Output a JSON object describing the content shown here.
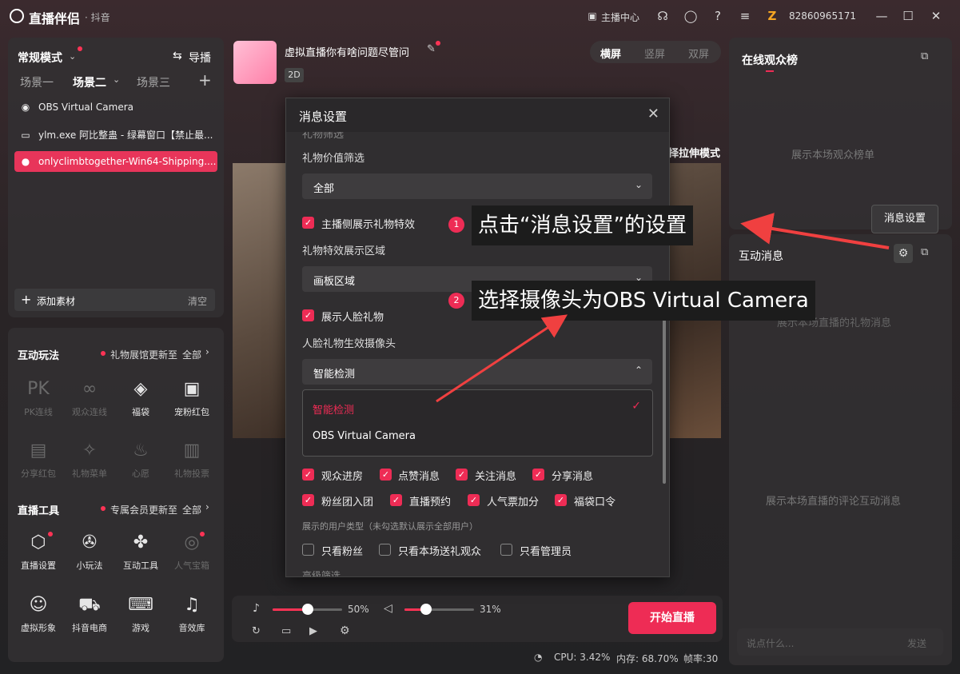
{
  "topbar": {
    "app_name": "直播伴侣",
    "platform": "· 抖音",
    "host_center": "主播中心",
    "user_id": "82860965171"
  },
  "left": {
    "mode": "常规模式",
    "guide": "导播",
    "scenes": [
      "场景一",
      "场景二",
      "场景三"
    ],
    "sources": [
      {
        "label": "OBS Virtual Camera"
      },
      {
        "label": "ylm.exe 阿比整蛊 - 绿幕窗口【禁止最..."
      },
      {
        "label": "onlyclimbtogether-Win64-Shipping...."
      }
    ],
    "add_source": "添加素材",
    "clear": "清空",
    "interactive_title": "互动玩法",
    "interactive_note": "礼物展馆更新至",
    "all": "全部",
    "interactive_tools": [
      "PK连线",
      "观众连线",
      "福袋",
      "宠粉红包",
      "分享红包",
      "礼物菜单",
      "心愿",
      "礼物投票"
    ],
    "tools_title": "直播工具",
    "tools_note": "专属会员更新至",
    "tools": [
      "直播设置",
      "小玩法",
      "互动工具",
      "人气宝箱",
      "虚拟形象",
      "抖音电商",
      "游戏",
      "音效库"
    ]
  },
  "center": {
    "stream_title": "虚拟直播你有啥问题尽管问",
    "tag": "2D",
    "orient": [
      "横屏",
      "竖屏",
      "双屏"
    ],
    "stretch_mode": "择拉伸模式",
    "mic_percent": "50%",
    "speaker_percent": "31%",
    "start": "开始直播",
    "cpu": "CPU: 3.42%",
    "mem": "内存: 68.70%",
    "fps": "帧率:30"
  },
  "dialog": {
    "title": "消息设置",
    "partial_top": "礼物筛选",
    "gift_value_label": "礼物价值筛选",
    "gift_value": "全部",
    "show_gift_effect": "主播侧展示礼物特效",
    "effect_area_label": "礼物特效展示区域",
    "effect_area": "画板区域",
    "show_face_gift": "展示人脸礼物",
    "face_camera_label": "人脸礼物生效摄像头",
    "face_camera": "智能检测",
    "options": [
      "智能检测",
      "OBS Virtual Camera"
    ],
    "checks_row1": [
      "观众进房",
      "点赞消息",
      "关注消息",
      "分享消息"
    ],
    "checks_row2": [
      "粉丝团入团",
      "直播预约",
      "人气票加分",
      "福袋口令"
    ],
    "user_type_label": "展示的用户类型（未勾选默认展示全部用户）",
    "user_types": [
      "只看粉丝",
      "只看本场送礼观众",
      "只看管理员"
    ],
    "partial_bottom": "高级筛选"
  },
  "annotations": {
    "step1": "点击“消息设置”的设置",
    "step2": "选择摄像头为OBS Virtual Camera",
    "n1": "1",
    "n2": "2"
  },
  "right": {
    "online_rank": "在线观众榜",
    "online_empty": "展示本场观众榜单",
    "tooltip": "消息设置",
    "interact_title": "互动消息",
    "gift_empty": "展示本场直播的礼物消息",
    "comment_empty": "展示本场直播的评论互动消息",
    "input_placeholder": "说点什么...",
    "send": "发送"
  },
  "colors": {
    "accent": "#ee2c55"
  }
}
